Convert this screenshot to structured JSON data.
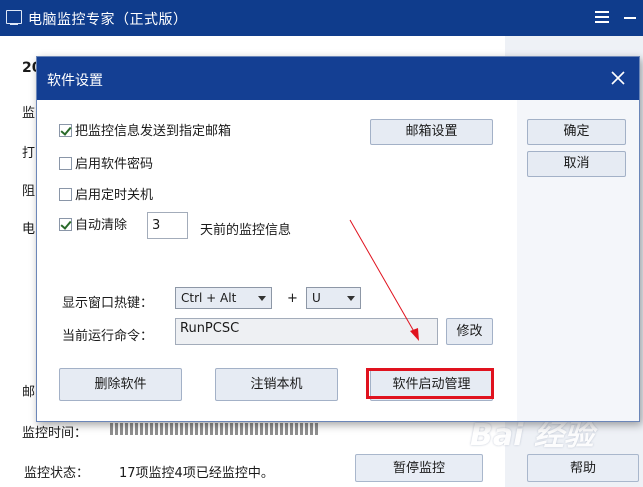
{
  "app": {
    "title": "电脑监控专家（正式版）",
    "icons": {
      "app": "monitor-icon",
      "menu": "menu-icon",
      "minimize": "minimize-icon"
    }
  },
  "background": {
    "partial_labels": [
      "20",
      "监",
      "打",
      "阻",
      "电",
      "邮"
    ],
    "status_row": {
      "label": "监控状态：",
      "value": "17项监控4项已经监控中。"
    },
    "obscured_row": "监控时间：",
    "buttons": {
      "pause": "暂停监控",
      "help": "帮助"
    }
  },
  "dialog": {
    "title": "软件设置",
    "options": [
      {
        "label": "把监控信息发送到指定邮箱",
        "checked": true
      },
      {
        "label": "启用软件密码",
        "checked": false
      },
      {
        "label": "启用定时关机",
        "checked": false
      },
      {
        "label": "自动清除",
        "checked": true
      }
    ],
    "auto_clear_days": "3",
    "auto_clear_suffix": "天前的监控信息",
    "email_settings_button": "邮箱设置",
    "ok_button": "确定",
    "cancel_button": "取消",
    "hotkey": {
      "label": "显示窗口热键：",
      "modifier": "Ctrl + Alt",
      "plus": "+",
      "key": "U"
    },
    "command": {
      "label": "当前运行命令：",
      "value": "RunPCSC",
      "modify_button": "修改"
    },
    "bottom_buttons": {
      "uninstall": "删除软件",
      "logoff": "注销本机",
      "startup_manager": "软件启动管理"
    },
    "highlight_color": "#e0121e"
  },
  "watermark": "Bai 经验"
}
